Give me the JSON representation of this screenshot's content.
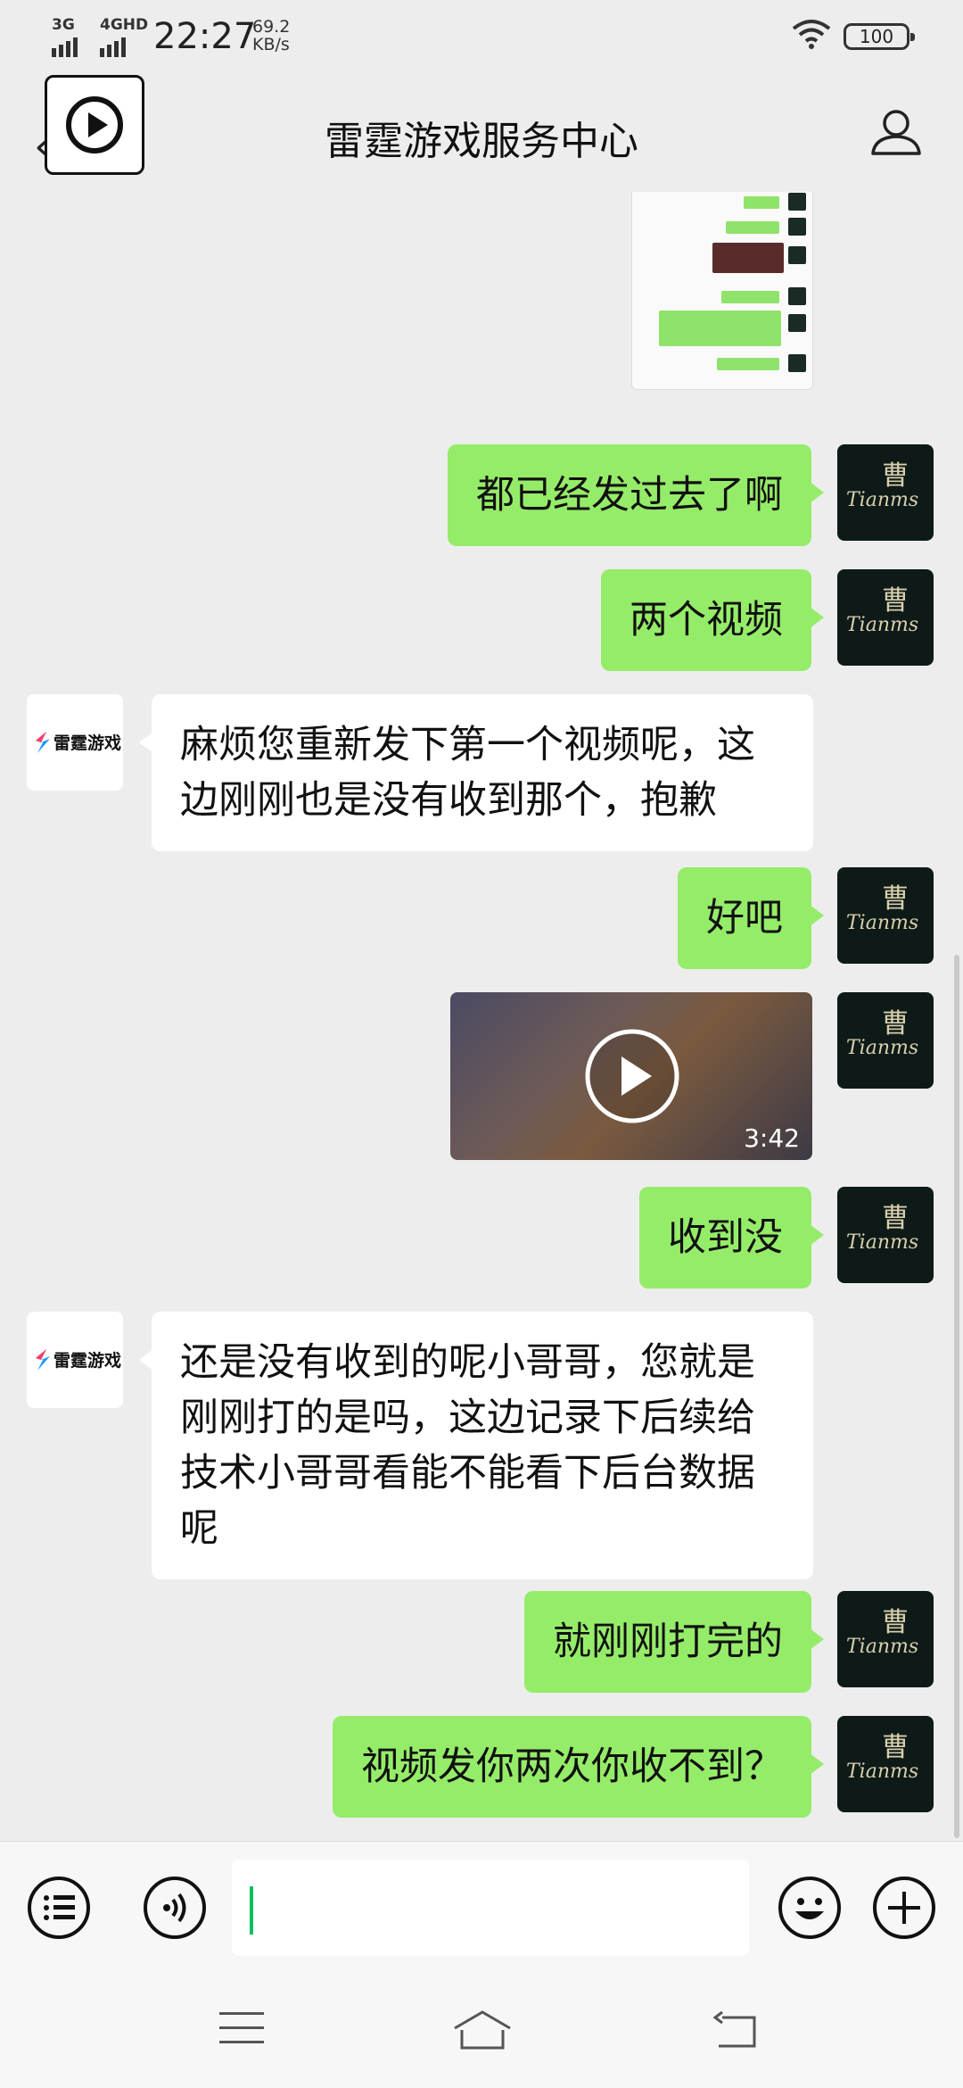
{
  "status_bar": {
    "signal1": "3G",
    "signal2": "4GHD",
    "time": "22:27",
    "speed_value": "69.2",
    "speed_unit": "KB/s",
    "battery": "100"
  },
  "header": {
    "title": "雷霆游戏服务中心",
    "back_icon": "chevron-left-icon",
    "play_icon": "play-circle-icon",
    "profile_icon": "person-icon"
  },
  "chat": {
    "brand_name": "雷霆游戏",
    "messages": [
      {
        "side": "out",
        "type": "image"
      },
      {
        "side": "out",
        "type": "text",
        "text": "都已经发过去了啊"
      },
      {
        "side": "out",
        "type": "text",
        "text": "两个视频"
      },
      {
        "side": "in",
        "type": "text",
        "text": "麻烦您重新发下第一个视频呢，这边刚刚也是没有收到那个，抱歉"
      },
      {
        "side": "out",
        "type": "text",
        "text": "好吧"
      },
      {
        "side": "out",
        "type": "video",
        "duration": "3:42"
      },
      {
        "side": "out",
        "type": "text",
        "text": "收到没"
      },
      {
        "side": "in",
        "type": "text",
        "text": "还是没有收到的呢小哥哥，您就是刚刚打的是吗，这边记录下后续给技术小哥哥看能不能看下后台数据呢"
      },
      {
        "side": "out",
        "type": "text",
        "text": "就刚刚打完的"
      },
      {
        "side": "out",
        "type": "text",
        "text": "视频发你两次你收不到？"
      }
    ]
  },
  "input_bar": {
    "menu_icon": "list-menu-icon",
    "voice_icon": "voice-icon",
    "emoji_icon": "emoji-icon",
    "plus_icon": "plus-icon",
    "text": ""
  },
  "nav_bar": {
    "menu_icon": "menu-lines-icon",
    "home_icon": "home-icon",
    "back_icon": "back-arrow-icon"
  },
  "colors": {
    "outgoing_bubble": "#95ec69",
    "incoming_bubble": "#ffffff",
    "background": "#ededed",
    "caret": "#07c160"
  }
}
